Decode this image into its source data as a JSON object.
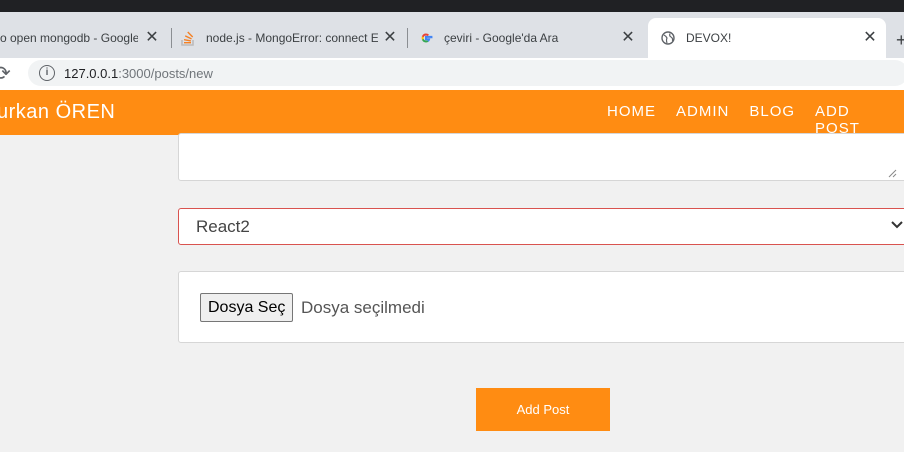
{
  "browser": {
    "tabs": [
      {
        "label": "o open mongodb - Google",
        "favicon": "none",
        "active": false
      },
      {
        "label": "node.js - MongoError: connect EC",
        "favicon": "stackoverflow-icon",
        "active": false
      },
      {
        "label": "çeviri - Google'da Ara",
        "favicon": "google-icon",
        "active": false
      },
      {
        "label": "DEVOX!",
        "favicon": "globe-icon",
        "active": true
      }
    ],
    "close_glyph": "✕",
    "new_tab_glyph": "+",
    "url_host": "127.0.0.1",
    "url_path": ":3000/posts/new"
  },
  "navbar": {
    "brand": "urkan ÖREN",
    "links": [
      "HOME",
      "ADMIN",
      "BLOG",
      "ADD POST"
    ],
    "color": "#ff8c12"
  },
  "form": {
    "textarea_value": "",
    "category_selected": "React2",
    "file_button_label": "Dosya Seç",
    "file_status": "Dosya seçilmedi",
    "submit_label": "Add Post"
  }
}
